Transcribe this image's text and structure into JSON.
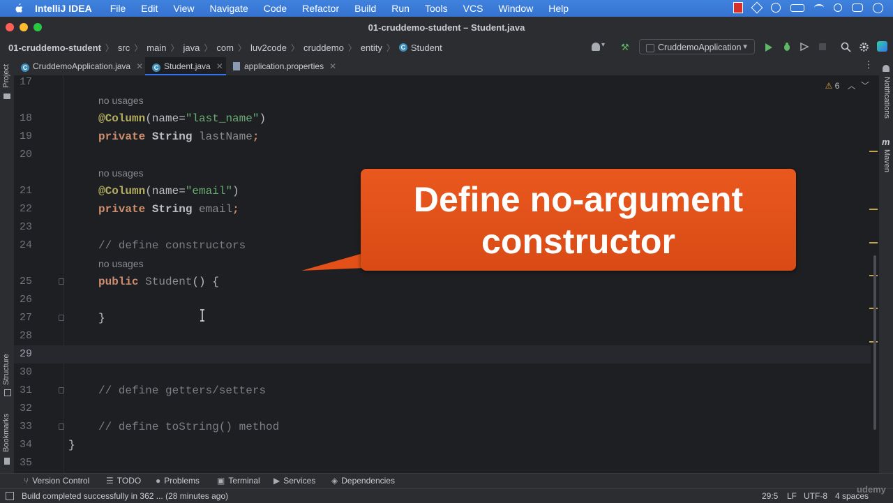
{
  "menubar": {
    "app": "IntelliJ IDEA",
    "items": [
      "File",
      "Edit",
      "View",
      "Navigate",
      "Code",
      "Refactor",
      "Build",
      "Run",
      "Tools",
      "VCS",
      "Window",
      "Help"
    ]
  },
  "window": {
    "title": "01-cruddemo-student – Student.java"
  },
  "breadcrumb": [
    "01-cruddemo-student",
    "src",
    "main",
    "java",
    "com",
    "luv2code",
    "cruddemo",
    "entity",
    "Student"
  ],
  "toolbar": {
    "run_config": "CruddemoApplication"
  },
  "tabs": [
    {
      "label": "CruddemoApplication.java",
      "active": false
    },
    {
      "label": "Student.java",
      "active": true
    },
    {
      "label": "application.properties",
      "active": false
    }
  ],
  "side": {
    "project": "Project",
    "structure": "Structure",
    "bookmarks": "Bookmarks",
    "notifications": "Notifications",
    "maven": "Maven",
    "maven_m": "m"
  },
  "editor": {
    "warnings": "6",
    "hint_no_usages": "no usages",
    "lines": {
      "l17": "17",
      "l18": "18",
      "l19": "19",
      "l20": "20",
      "l21": "21",
      "l22": "22",
      "l23": "23",
      "l24": "24",
      "l25": "25",
      "l26": "26",
      "l27": "27",
      "l28": "28",
      "l29": "29",
      "l30": "30",
      "l31": "31",
      "l32": "32",
      "l33": "33",
      "l34": "34",
      "l35": "35"
    },
    "code": {
      "column": "@Column",
      "name_eq": "(name=",
      "last_name_str": "\"last_name\"",
      "email_str": "\"email\"",
      "close_paren": ")",
      "private": "private",
      "string": "String",
      "lastName": "lastName",
      "email": "email",
      "semi": ";",
      "cmt_constructors": "// define constructors",
      "public": "public",
      "student": "Student",
      "parens_brace": "() {",
      "close_brace": "}",
      "cmt_getters": "// define getters/setters",
      "cmt_tostring": "// define toString() method"
    }
  },
  "callout": {
    "line1": "Define no-argument",
    "line2": "constructor"
  },
  "toolwindows": [
    "Version Control",
    "TODO",
    "Problems",
    "Terminal",
    "Services",
    "Dependencies"
  ],
  "status": {
    "message": "Build completed successfully in 362 ... (28 minutes ago)",
    "position": "29:5",
    "line_sep": "LF",
    "encoding": "UTF-8",
    "indent": "4 spaces",
    "watermark": "udemy"
  },
  "colors": {
    "accent": "#3574f0",
    "callout": "#e8541c",
    "keyword": "#cf8e6d",
    "annotation": "#b3ae60",
    "string": "#6aab73",
    "field": "#c77dbb"
  }
}
